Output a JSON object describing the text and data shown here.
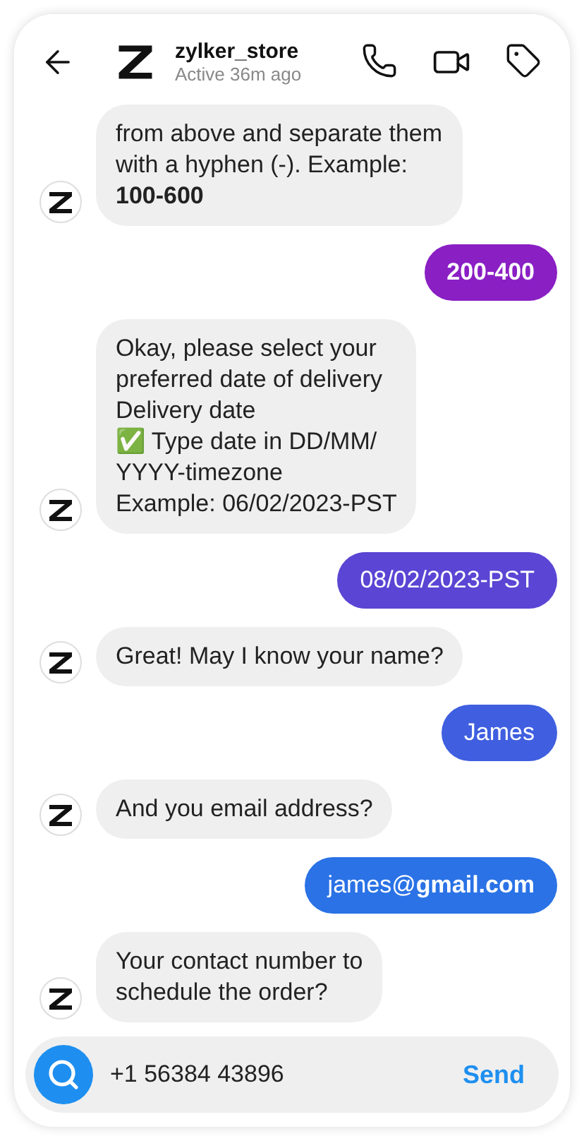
{
  "header": {
    "name": "zylker_store",
    "status": "Active 36m ago"
  },
  "messages": [
    {
      "kind": "bot",
      "text": "from above and separate them\nwith a hyphen (-). Example:\n**100-600**"
    },
    {
      "kind": "user",
      "text": "**200-400**",
      "color": "#8a1fc4"
    },
    {
      "kind": "bot",
      "text": "Okay, please select your\npreferred date of delivery\nDelivery date\n✅ Type date in DD/MM/\nYYYY-timezone\n Example: 06/02/2023-PST"
    },
    {
      "kind": "user",
      "text": "08/02/2023-PST",
      "color": "#5a45d4"
    },
    {
      "kind": "bot",
      "text": "Great! May I know your name?"
    },
    {
      "kind": "user",
      "text": "James",
      "color": "#3f5fe0"
    },
    {
      "kind": "bot",
      "text": "And you email address?"
    },
    {
      "kind": "user",
      "text": "james@**gmail.com**",
      "color": "#2a72e6"
    },
    {
      "kind": "bot",
      "text": "Your contact number to\nschedule the order?"
    }
  ],
  "composer": {
    "value": "+1 56384 43896",
    "send": "Send"
  }
}
